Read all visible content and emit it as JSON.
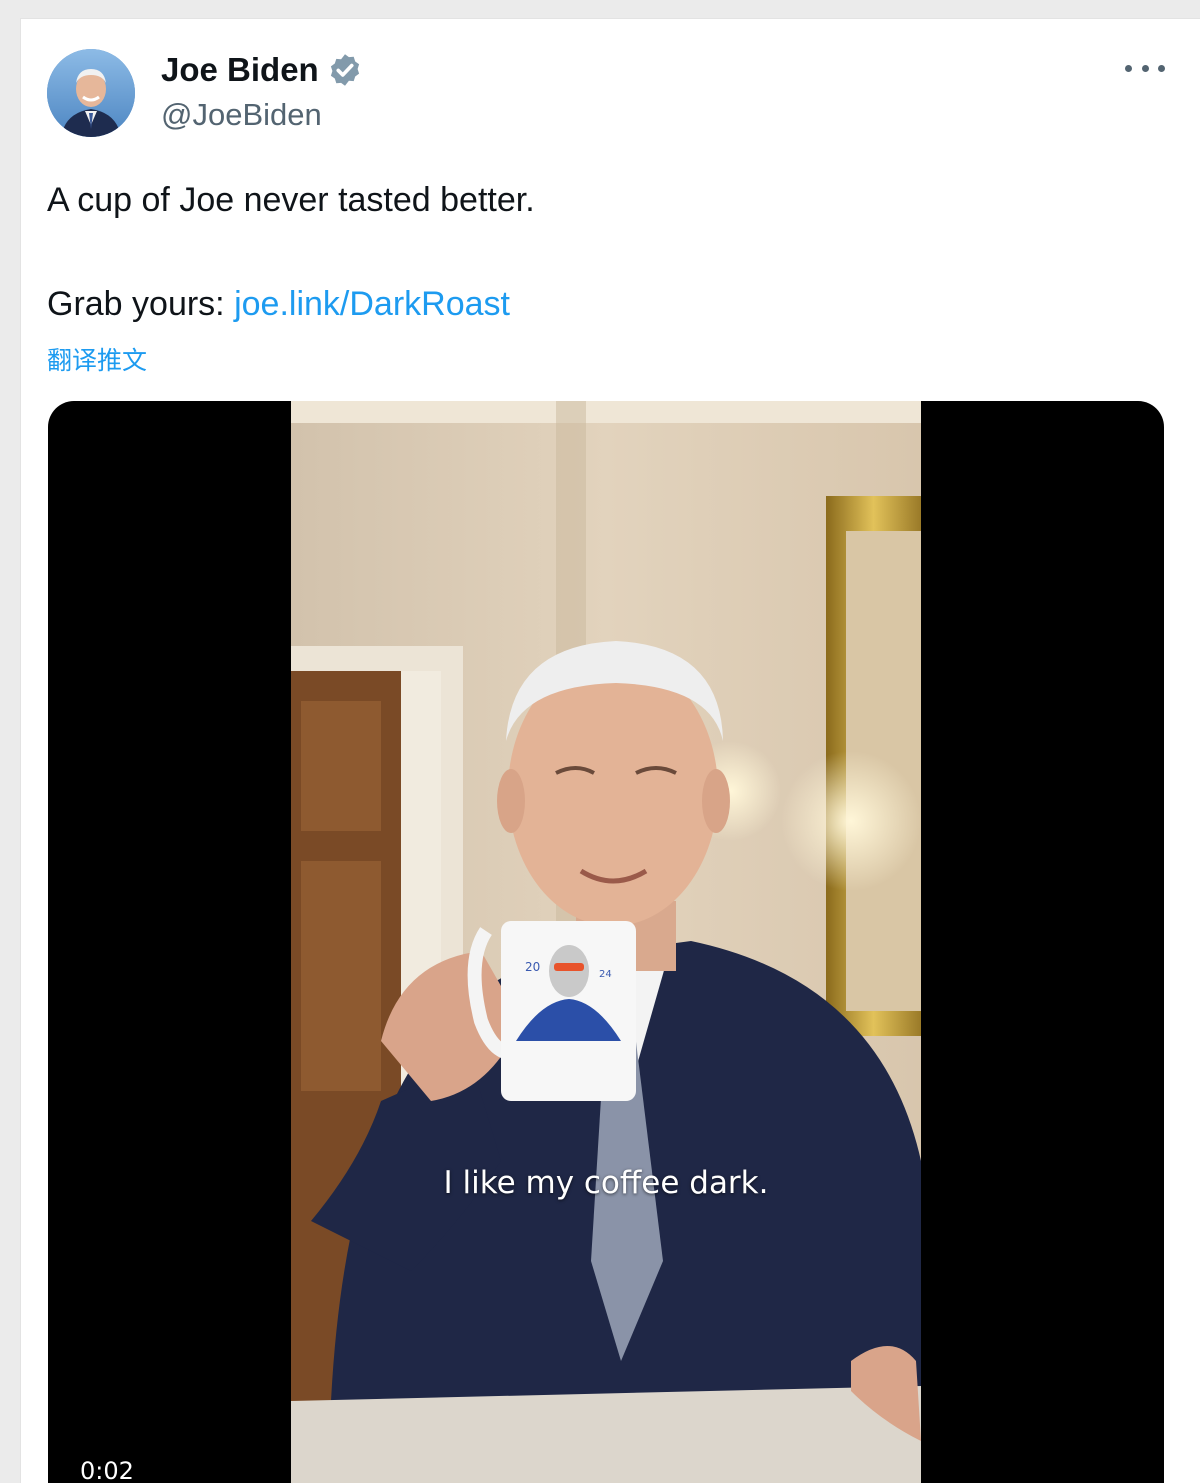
{
  "author": {
    "name": "Joe Biden",
    "handle": "@JoeBiden",
    "verified": true,
    "avatar_icon": "avatar"
  },
  "tweet": {
    "line1": "A cup of Joe never tasted better.",
    "line2_prefix": "Grab yours: ",
    "link_text": "joe.link/DarkRoast",
    "translate_label": "翻译推文"
  },
  "video": {
    "caption": "I like my coffee dark.",
    "timestamp": "0:02",
    "mug_text_left": "20",
    "mug_text_right": "24"
  },
  "colors": {
    "link": "#1d9bf0",
    "text": "#0f1419",
    "muted": "#536471"
  }
}
